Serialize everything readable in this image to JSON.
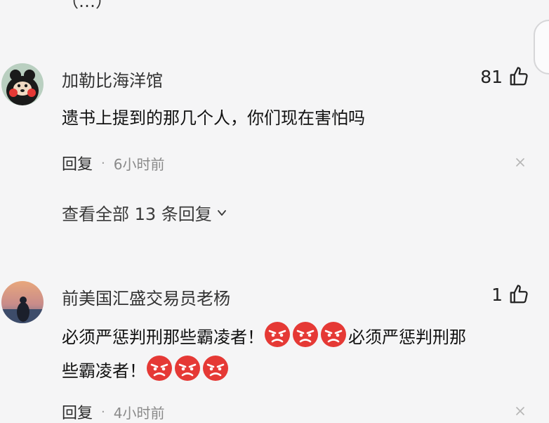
{
  "partial_top": {
    "text": "（…）"
  },
  "comments": [
    {
      "username": "加勒比海洋馆",
      "like_count": "81",
      "text": "遗书上提到的那几个人，你们现在害怕吗",
      "reply_label": "回复",
      "timestamp": "6小时前",
      "view_replies": "查看全部 13 条回复"
    },
    {
      "username": "前美国汇盛交易员老杨",
      "like_count": "1",
      "text_part1": "必须严惩判刑那些霸凌者！",
      "text_part2": "必须严惩判刑那",
      "text_part3": "些霸凌者！",
      "reply_label": "回复",
      "timestamp": "4小时前"
    }
  ],
  "icons": {
    "like": "thumbs-up-icon",
    "close": "close-icon",
    "chevron": "chevron-down-icon",
    "emoji": "angry-face-emoji"
  },
  "colors": {
    "background": "#f5f5f6",
    "emoji_red": "#e53935",
    "muted_text": "#8a8a8a"
  }
}
